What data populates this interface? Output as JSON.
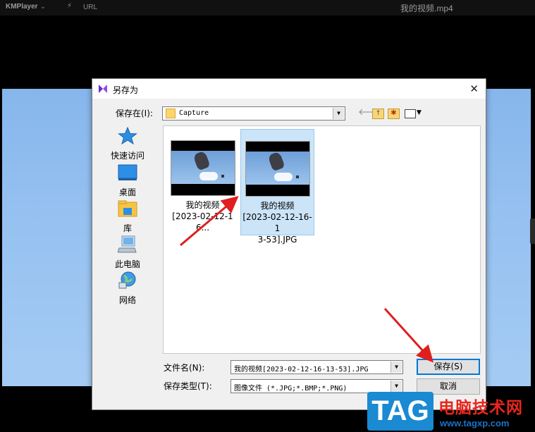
{
  "player": {
    "brand": "KMPlayer",
    "brand_caret": "⌄",
    "url_label": "URL",
    "window_title": "我的视频.mp4"
  },
  "dialog": {
    "title": "另存为",
    "close": "✕",
    "save_in_label": "保存在(I):",
    "save_in_value": "Capture",
    "places": [
      {
        "label": "快速访问",
        "icon": "star-icon"
      },
      {
        "label": "桌面",
        "icon": "desktop-icon"
      },
      {
        "label": "库",
        "icon": "library-folder-icon"
      },
      {
        "label": "此电脑",
        "icon": "computer-icon"
      },
      {
        "label": "网络",
        "icon": "network-globe-icon"
      }
    ],
    "files": [
      {
        "name": "我的视频\n[2023-02-12-16...",
        "selected": false
      },
      {
        "name": "我的视频\n[2023-02-12-16-1\n3-53].JPG",
        "selected": true
      }
    ],
    "file_name_label": "文件名(N):",
    "file_name_value": "我的视频[2023-02-12-16-13-53].JPG",
    "file_type_label": "保存类型(T):",
    "file_type_value": "图像文件 (*.JPG;*.BMP;*.PNG)",
    "save_button": "保存(S)",
    "cancel_button": "取消"
  },
  "watermark": {
    "tag": "TAG",
    "site_name": "电脑技术网",
    "url": "www.tagxp.com"
  },
  "colors": {
    "accent": "#0078d7",
    "selection": "#cce4f7",
    "annotation_arrow": "#e01e1e",
    "watermark_blue": "#1a8ad2",
    "watermark_red": "#e8261c"
  }
}
